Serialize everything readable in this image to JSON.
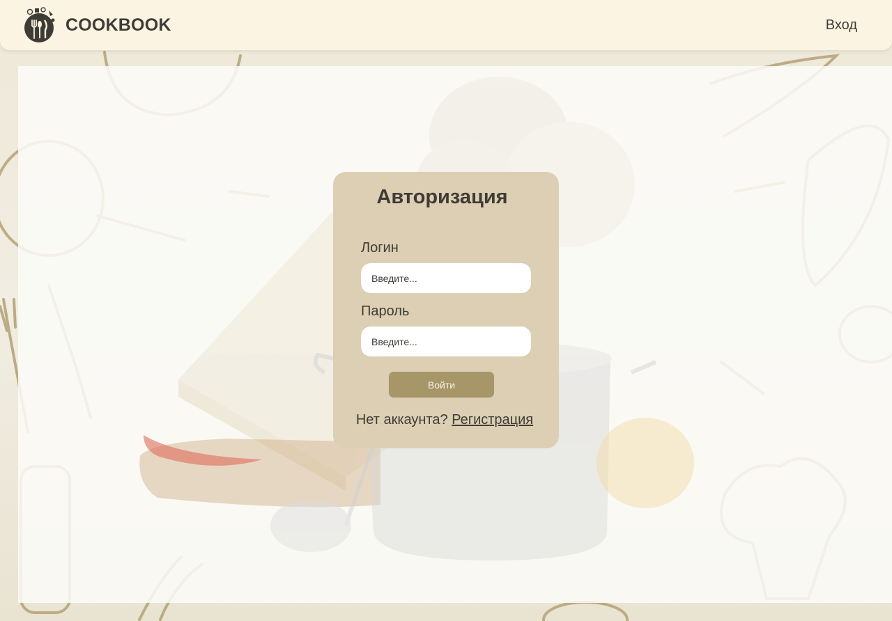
{
  "header": {
    "brand": "COOKBOOK",
    "login_link": "Вход",
    "logo_icon": "fork-spoon-knife-logo-icon"
  },
  "auth": {
    "title": "Авторизация",
    "login_label": "Логин",
    "login_placeholder": "Введите...",
    "password_label": "Пароль",
    "password_placeholder": "Введите...",
    "submit_label": "Войти",
    "no_account_text": "Нет аккаунта?",
    "register_link": "Регистрация"
  },
  "colors": {
    "header_bg": "#fcf4e2",
    "card_bg": "#dccfb3",
    "button_bg": "#a69668",
    "text_dark": "#3f3c36",
    "sketch": "#b7a57a"
  }
}
